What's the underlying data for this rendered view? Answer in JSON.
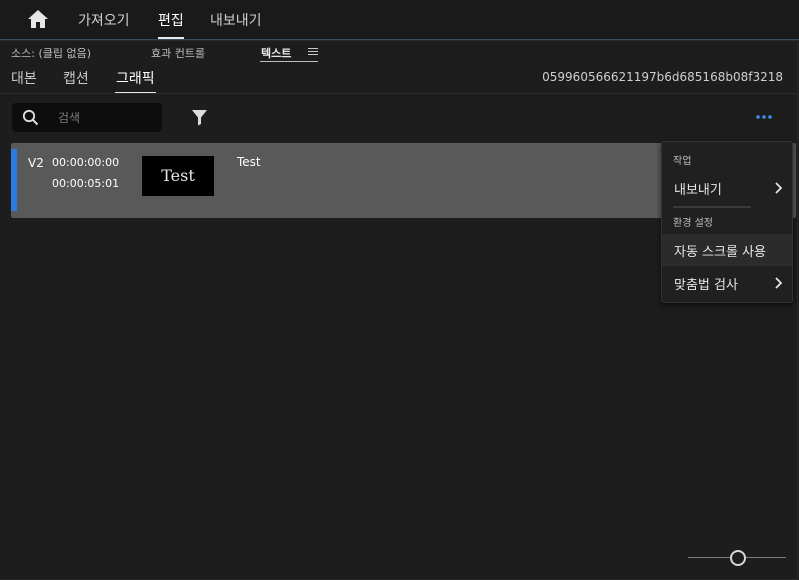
{
  "topbar": {
    "tabs": [
      "가져오기",
      "편집",
      "내보내기"
    ]
  },
  "panel_header": {
    "source": "소스: (클립 없음)",
    "effect_controls": "효과 컨트롤",
    "text": "텍스트"
  },
  "subtabs": [
    "대본",
    "캡션",
    "그래픽"
  ],
  "hash_id": "05996056662​1197b6d685168b08f3218",
  "search": {
    "placeholder": "검색"
  },
  "clip": {
    "track": "V2",
    "timecode_start": "00:00:00:00",
    "timecode_end": "00:00:05:01",
    "thumbnail_text": "Test",
    "title": "Test"
  },
  "menu": {
    "section_action": "작업",
    "export": "내보내기",
    "section_prefs": "환경 설정",
    "auto_scroll": "자동 스크롤 사용",
    "spell_check": "맞춤법 검사"
  },
  "colors": {
    "accent": "#2e7be0",
    "clip_bg": "#595959",
    "panel_bg": "#1d1d1d"
  }
}
